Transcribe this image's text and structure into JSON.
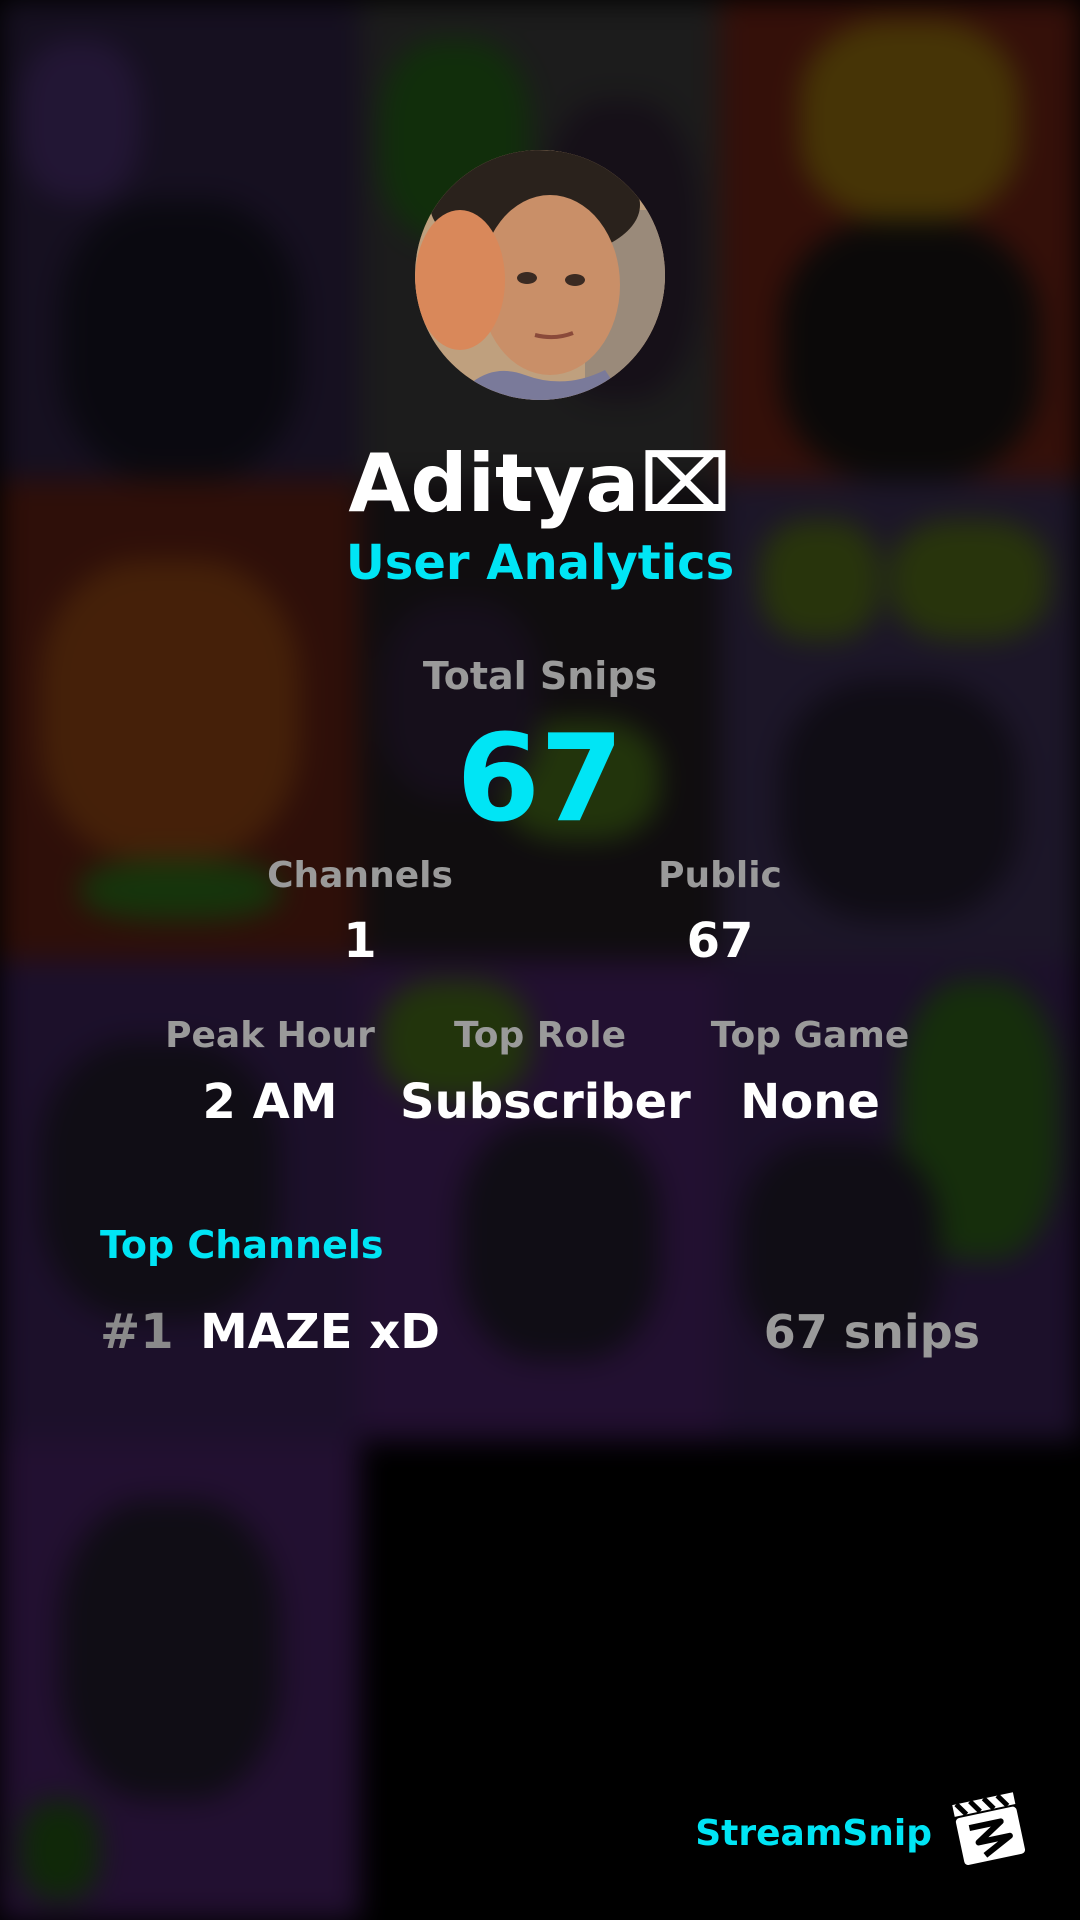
{
  "profile": {
    "username": "Aditya⌧",
    "subtitle": "User Analytics"
  },
  "stats": {
    "total_label": "Total Snips",
    "total_value": "67",
    "channels_label": "Channels",
    "channels_value": "1",
    "public_label": "Public",
    "public_value": "67",
    "peak_hour_label": "Peak Hour",
    "peak_hour_value": "2 AM",
    "top_role_label": "Top Role",
    "top_role_value": "Subscriber",
    "top_game_label": "Top Game",
    "top_game_value": "None"
  },
  "top_channels": {
    "title": "Top Channels",
    "items": [
      {
        "rank": "#1",
        "name": "MAZE xD",
        "count": "67 snips"
      }
    ]
  },
  "branding": {
    "name": "StreamSnip",
    "logo_icon": "clapperboard-icon"
  },
  "colors": {
    "accent": "#00e5f5",
    "muted": "#9a9a9a",
    "text": "#ffffff",
    "background": "#000000"
  }
}
